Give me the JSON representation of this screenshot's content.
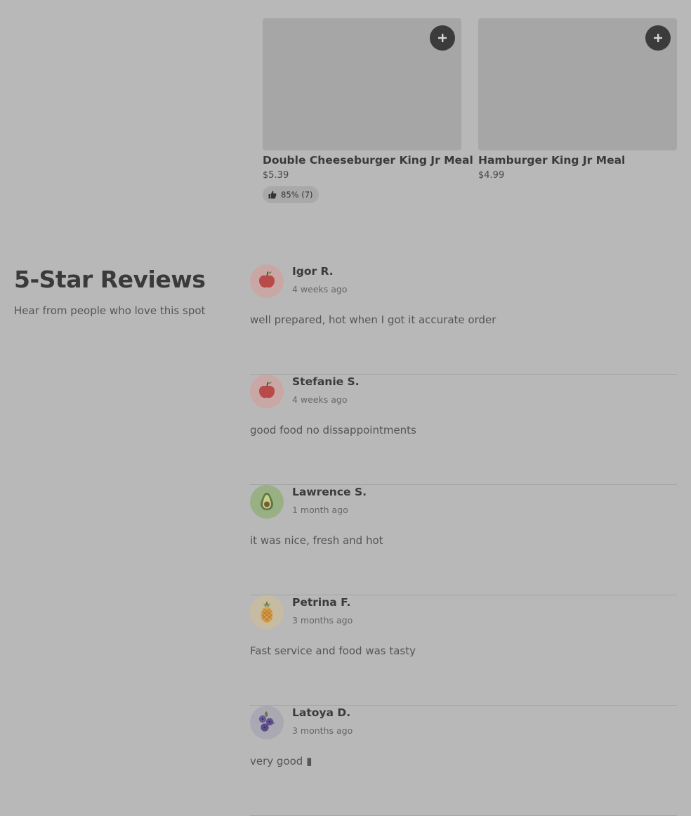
{
  "products": [
    {
      "name": "Double Cheeseburger King Jr Meal",
      "price": "$5.39",
      "rating": "85% (7)",
      "add_icon": "plus-icon"
    },
    {
      "name": "Hamburger King Jr Meal",
      "price": "$4.99",
      "add_icon": "plus-icon"
    }
  ],
  "reviews_section": {
    "title": "5-Star Reviews",
    "subtitle": "Hear from people who love this spot",
    "reviews": [
      {
        "author": "Igor R.",
        "date": "4 weeks ago",
        "text": "well prepared, hot when I got it accurate order",
        "avatar": "apple-icon"
      },
      {
        "author": "Stefanie S.",
        "date": "4 weeks ago",
        "text": "good food no dissappointments",
        "avatar": "apple-icon"
      },
      {
        "author": "Lawrence S.",
        "date": "1 month ago",
        "text": "it was nice, fresh and hot",
        "avatar": "avocado-icon"
      },
      {
        "author": "Petrina F.",
        "date": "3 months ago",
        "text": "Fast service and food was tasty",
        "avatar": "pineapple-icon"
      },
      {
        "author": "Latoya D.",
        "date": "3 months ago",
        "text": "very good ▮",
        "avatar": "blueberries-icon"
      }
    ]
  },
  "colors": {
    "overlay_bg": "#b8b8b8",
    "add_button": "#3b3b3b",
    "image_placeholder": "#a6a6a6"
  }
}
